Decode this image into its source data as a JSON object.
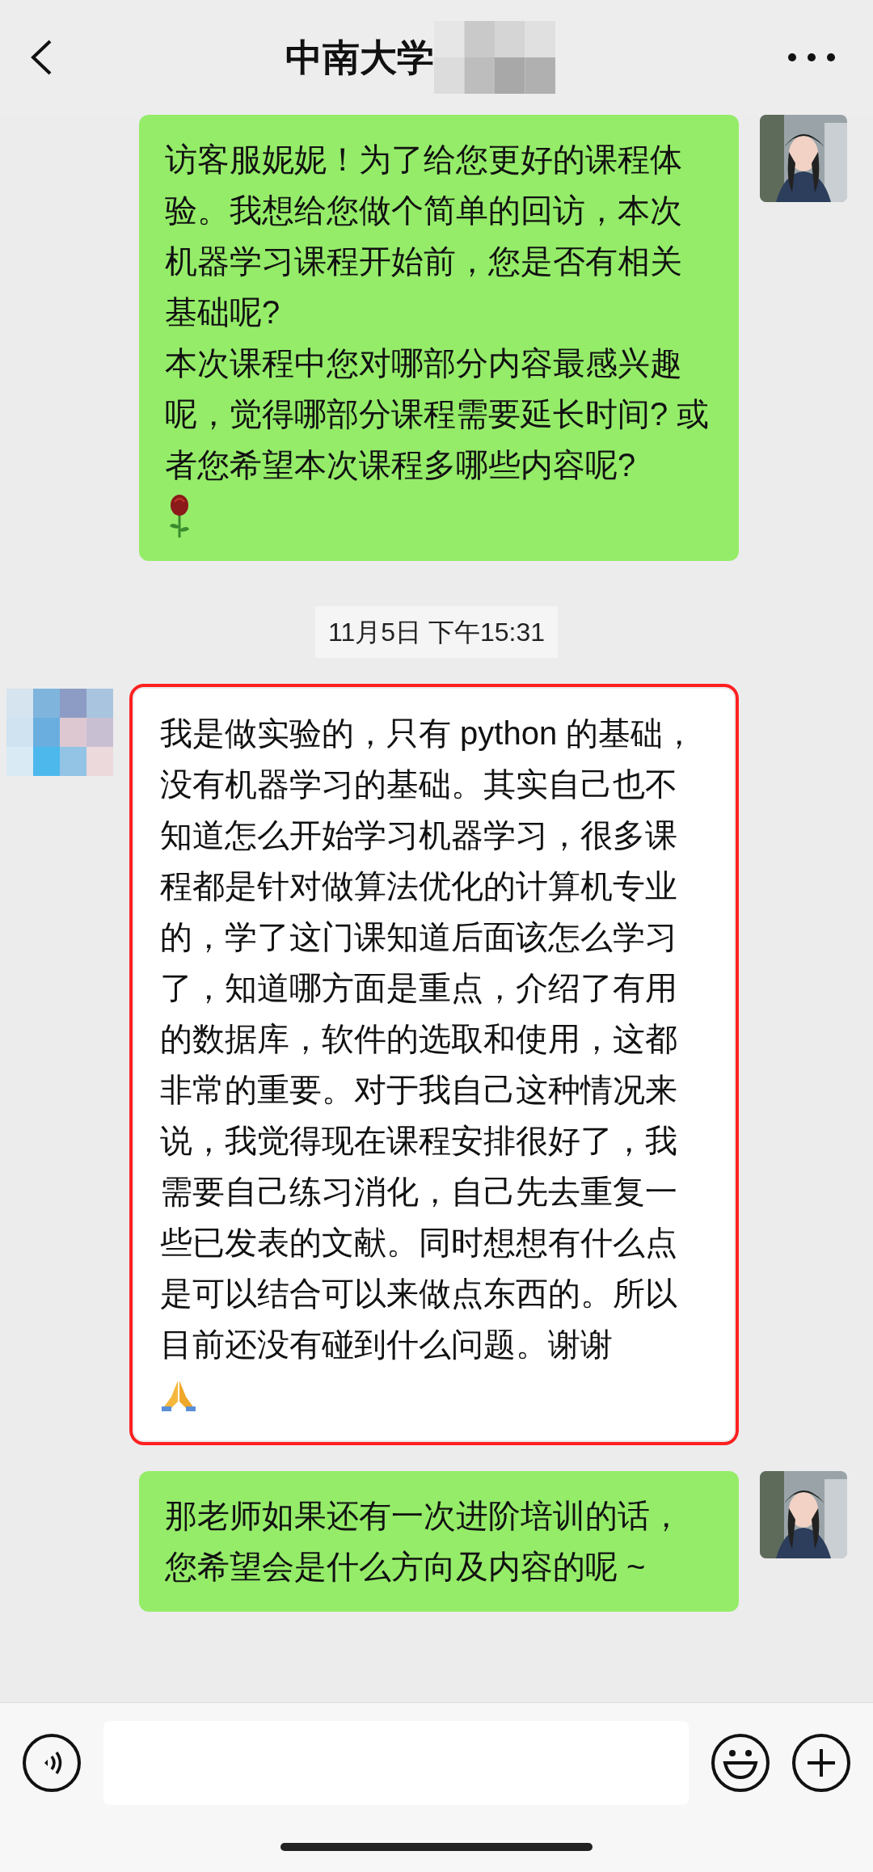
{
  "header": {
    "title": "中南大学"
  },
  "messages": [
    {
      "kind": "outgoing",
      "text": "访客服妮妮！为了给您更好的课程体验。我想给您做个简单的回访，本次机器学习课程开始前，您是否有相关基础呢?\n本次课程中您对哪部分内容最感兴趣呢，觉得哪部分课程需要延长时间? 或者您希望本次课程多哪些内容呢? ",
      "end_icon": {
        "kind": "rose"
      },
      "highlighted": false
    },
    {
      "kind": "time",
      "text": "11月5日 下午15:31"
    },
    {
      "kind": "incoming",
      "text": "我是做实验的，只有 python 的基础，没有机器学习的基础。其实自己也不知道怎么开始学习机器学习，很多课程都是针对做算法优化的计算机专业的，学了这门课知道后面该怎么学习了，知道哪方面是重点，介绍了有用的数据库，软件的选取和使用，这都非常的重要。对于我自己这种情况来说，我觉得现在课程安排很好了，我需要自己练习消化，自己先去重复一些已发表的文献。同时想想有什么点是可以结合可以来做点东西的。所以目前还没有碰到什么问题。谢谢",
      "end_icon": {
        "kind": "pray"
      },
      "highlighted": true
    },
    {
      "kind": "outgoing",
      "text": "那老师如果还有一次进阶培训的话，您希望会是什么方向及内容的呢 ~",
      "highlighted": false
    }
  ]
}
